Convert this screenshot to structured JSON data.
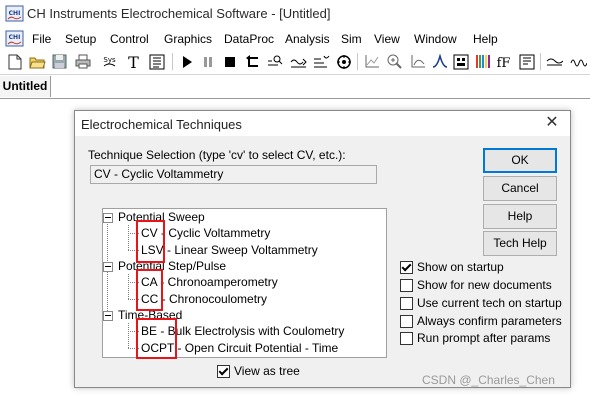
{
  "window": {
    "title": "CH Instruments Electrochemical Software - [Untitled]",
    "app_icon_text": "CHI"
  },
  "menu": [
    "File",
    "Setup",
    "Control",
    "Graphics",
    "DataProc",
    "Analysis",
    "Sim",
    "View",
    "Window",
    "Help"
  ],
  "toolbar": {
    "icons": [
      "new-file-icon",
      "open-folder-icon",
      "save-icon",
      "print-icon",
      "sys-icon",
      "text-icon",
      "list-icon",
      "run-icon",
      "pause-icon",
      "stop-icon",
      "reverse-icon",
      "zoom-icon",
      "sweep-icon",
      "filter-icon",
      "settings-icon",
      "graph-icon",
      "zoom-in-icon",
      "manual-icon",
      "peak-icon",
      "overlay-icon",
      "color-icon",
      "font-icon",
      "font-color-icon",
      "smooth-icon",
      "wave-icon"
    ],
    "sys_label": "Sys",
    "text_label": "T",
    "font_label": "fF"
  },
  "document_tab": "Untitled",
  "dialog": {
    "title": "Electrochemical Techniques",
    "close_glyph": "✕",
    "selection_label": "Technique Selection (type 'cv' to select CV, etc.):",
    "selection_value": "CV - Cyclic Voltammetry",
    "buttons": {
      "ok": "OK",
      "cancel": "Cancel",
      "help": "Help",
      "tech_help": "Tech Help"
    },
    "tree": {
      "groups": [
        {
          "label": "Potential Sweep",
          "items": [
            {
              "code": "CV",
              "rest": " - Cyclic Voltammetry"
            },
            {
              "code": "LSV",
              "rest": " - Linear Sweep Voltammetry"
            }
          ]
        },
        {
          "label": "Potential Step/Pulse",
          "items": [
            {
              "code": "CA",
              "rest": " - Chronoamperometry"
            },
            {
              "code": "CC",
              "rest": " - Chronocoulometry"
            }
          ]
        },
        {
          "label": "Time-Based",
          "items": [
            {
              "code": "BE",
              "rest": " - Bulk Electrolysis with Coulometry"
            },
            {
              "code": "OCPT",
              "rest": " - Open Circuit Potential - Time"
            }
          ]
        }
      ]
    },
    "view_as_tree": {
      "label": "View as tree",
      "checked": true
    },
    "options": [
      {
        "label": "Show on startup",
        "checked": true
      },
      {
        "label": "Show for new documents",
        "checked": false
      },
      {
        "label": "Use current tech on startup",
        "checked": false
      },
      {
        "label": "Always confirm parameters",
        "checked": false
      },
      {
        "label": "Run prompt after params",
        "checked": false
      }
    ]
  },
  "watermark": "CSDN @_Charles_Chen",
  "colors": {
    "highlight_box": "#e8141a",
    "default_button_border": "#0078d7"
  }
}
